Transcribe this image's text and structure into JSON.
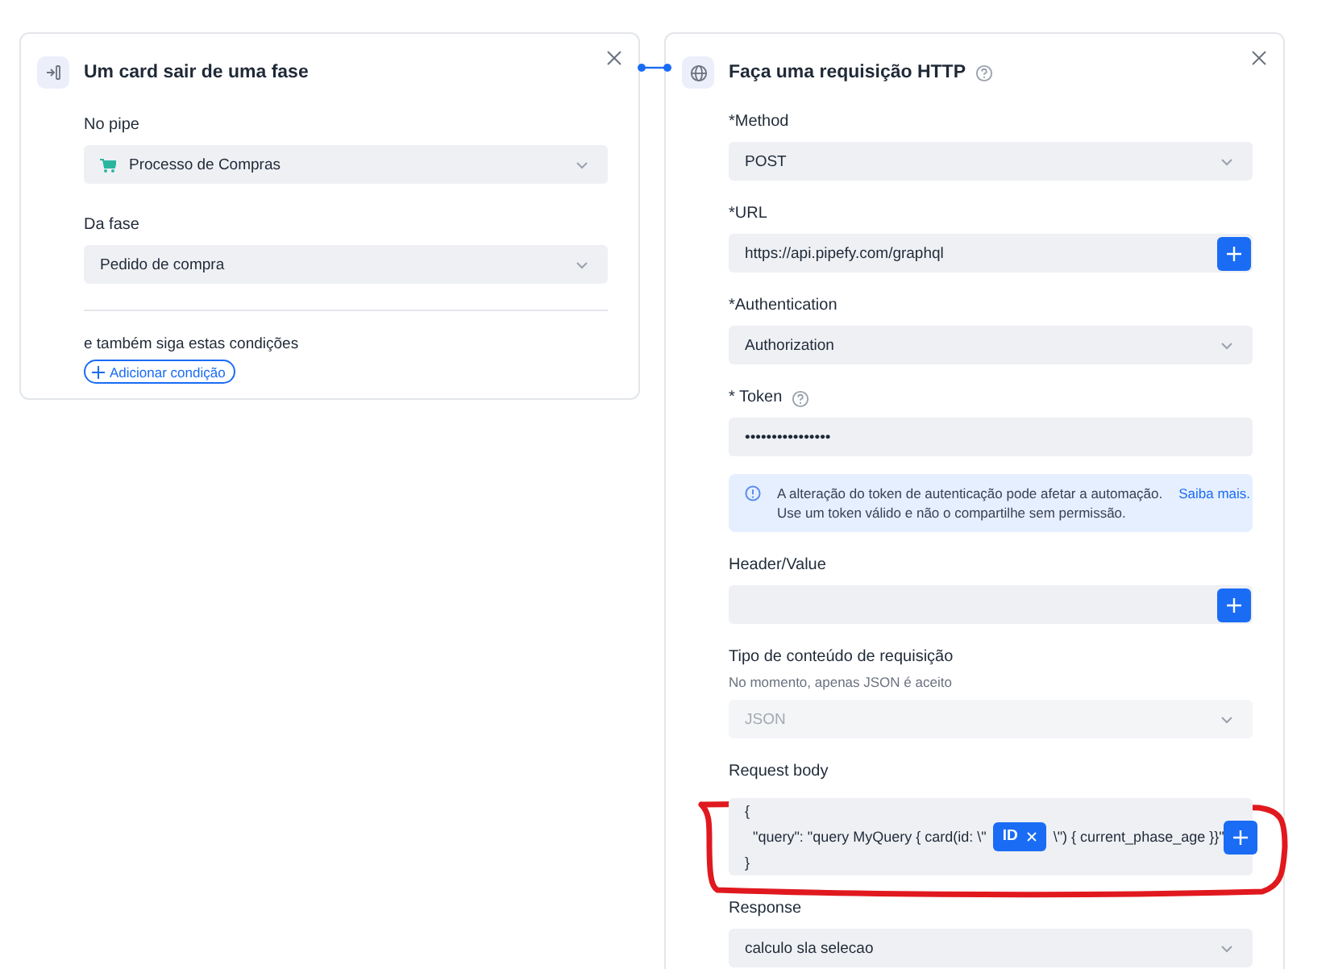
{
  "trigger_card": {
    "title": "Um card sair de uma fase",
    "fields": [
      {
        "label": "No pipe",
        "value": "Processo de Compras",
        "icon": true
      },
      {
        "label": "Da fase",
        "value": "Pedido de compra",
        "icon": false
      }
    ],
    "conditions_label": "e também siga estas condições",
    "add_condition_button": "Adicionar condição"
  },
  "action_card": {
    "title": "Faça uma requisição HTTP",
    "help": true,
    "fields": [
      {
        "kind": "select",
        "label": "*Method",
        "value": "POST",
        "disabled": false
      },
      {
        "kind": "input_add",
        "label": "*URL",
        "value": "https://api.pipefy.com/graphql"
      },
      {
        "kind": "select",
        "label": "*Authentication",
        "value": "Authorization",
        "disabled": false
      },
      {
        "kind": "password",
        "label": "* Token",
        "help": true,
        "value": "••••••••••••••••"
      },
      {
        "kind": "notice",
        "lines": [
          "A alteração do token de autenticação pode afetar a automação.",
          "Use um token válido e não o compartilhe sem permissão."
        ],
        "link": "Saiba mais."
      },
      {
        "kind": "input_add",
        "label": "Header/Value"
      },
      {
        "kind": "select",
        "label": "Tipo de conteúdo de requisição",
        "hint": "No momento, apenas JSON é aceito",
        "value": "JSON",
        "disabled": true
      },
      {
        "kind": "body",
        "label": "Request body",
        "open": "{",
        "before": "\"query\": \"query MyQuery { card(id: \\\"",
        "chip": "ID",
        "after": "\\\") { current_phase_age }}\"",
        "close": "}"
      },
      {
        "kind": "select",
        "label": "Response",
        "value": "calculo sla selecao",
        "disabled": false
      }
    ]
  }
}
